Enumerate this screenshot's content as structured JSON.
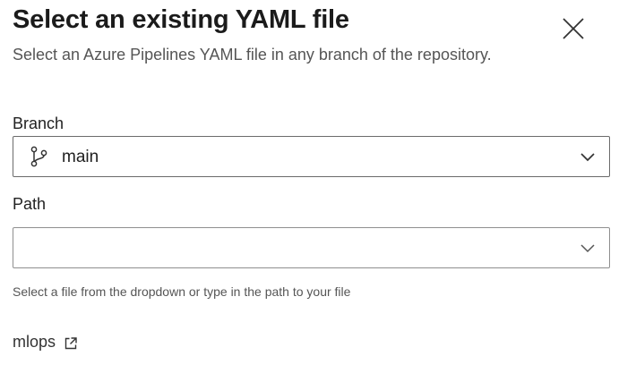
{
  "dialog": {
    "title": "Select an existing YAML file",
    "subtitle": "Select an Azure Pipelines YAML file in any branch of the repository.",
    "close_icon": "close-icon"
  },
  "branch": {
    "label": "Branch",
    "value": "main",
    "icon": "branch-icon",
    "dropdown_icon": "chevron-down-icon"
  },
  "path": {
    "label": "Path",
    "value": "",
    "placeholder": "",
    "dropdown_icon": "chevron-down-icon",
    "helper_text": "Select a file from the dropdown or type in the path to your file"
  },
  "repository": {
    "link_text": "mlops",
    "icon": "external-link-icon"
  }
}
